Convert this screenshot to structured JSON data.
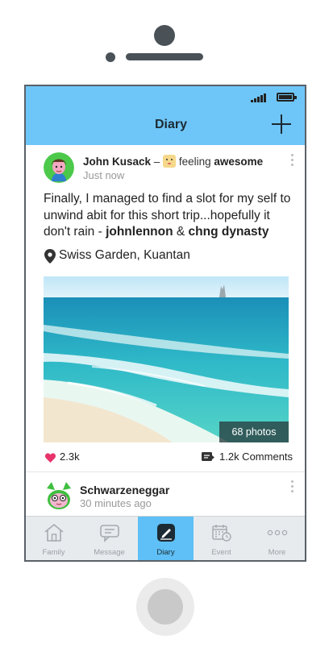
{
  "app": {
    "title": "Diary"
  },
  "post": {
    "author": "John Kusack",
    "dash": "–",
    "feeling_prefix": "feeling",
    "feeling": "awesome",
    "time": "Just now",
    "text_1": "Finally, I managed to find a slot for my self to unwind abit for this short trip...hopefully it don't rain - ",
    "tag_1": "johnlennon",
    "amp": " & ",
    "tag_2": "chng dynasty",
    "location": "Swiss Garden, Kuantan",
    "photo_count": "68 photos",
    "likes": "2.3k",
    "comments": "1.2k Comments"
  },
  "post2": {
    "author": "Schwarzeneggar",
    "time": "30 minutes ago"
  },
  "tabs": [
    {
      "label": "Family",
      "icon": "house-icon"
    },
    {
      "label": "Message",
      "icon": "chat-bubble-icon"
    },
    {
      "label": "Diary",
      "icon": "diary-pen-icon",
      "active": true
    },
    {
      "label": "Event",
      "icon": "calendar-clock-icon"
    },
    {
      "label": "More",
      "icon": "more-dots-icon"
    }
  ],
  "colors": {
    "accent": "#6ec6f8",
    "active_tab": "#5ec0f6",
    "heart": "#e8336b",
    "phone_frame": "#5a6168"
  }
}
